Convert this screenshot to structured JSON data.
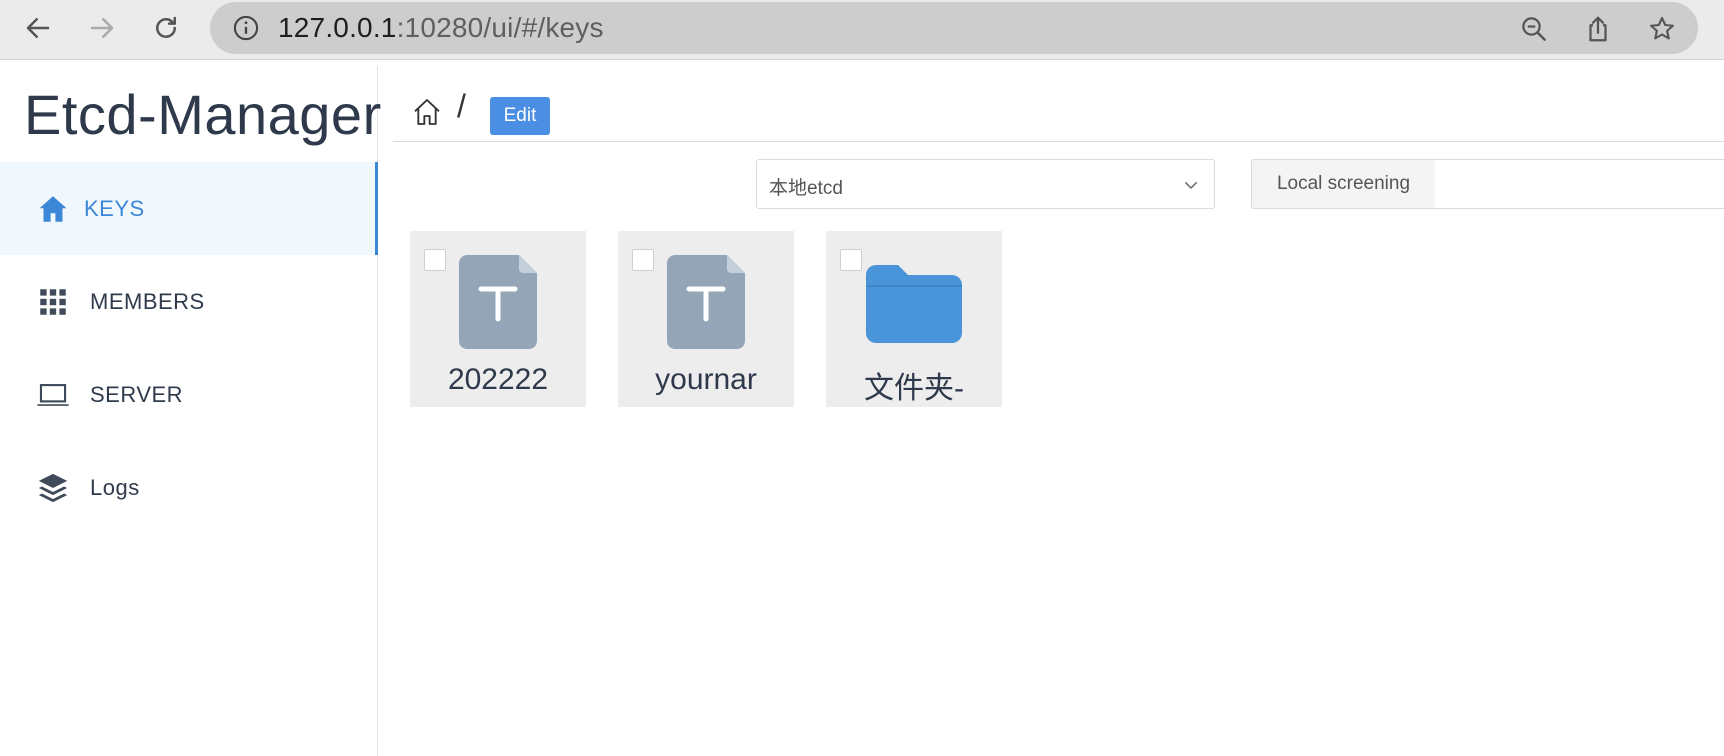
{
  "browser": {
    "url_host": "127.0.0.1",
    "url_rest": ":10280/ui/#/keys"
  },
  "sidebar": {
    "brand": "Etcd-Manager",
    "items": [
      {
        "label": "KEYS",
        "icon": "home-icon",
        "active": true
      },
      {
        "label": "MEMBERS",
        "icon": "grid-icon",
        "active": false
      },
      {
        "label": "SERVER",
        "icon": "laptop-icon",
        "active": false
      },
      {
        "label": "Logs",
        "icon": "layers-icon",
        "active": false
      }
    ]
  },
  "main": {
    "breadcrumb_separator": "/",
    "edit_label": "Edit",
    "server_select": "本地etcd",
    "filter_label": "Local screening",
    "filter_value": "",
    "items": [
      {
        "name": "202222",
        "type": "text-file",
        "icon": "text-file-icon"
      },
      {
        "name": "yournar",
        "type": "text-file",
        "icon": "text-file-icon"
      },
      {
        "name": "文件夹-",
        "type": "folder",
        "icon": "folder-icon"
      }
    ]
  },
  "colors": {
    "accent": "#3d87d9",
    "edit_button": "#4a8fe3",
    "file_icon": "#94a5b8",
    "folder_icon": "#4a94d9",
    "tile_bg": "#ededed"
  }
}
